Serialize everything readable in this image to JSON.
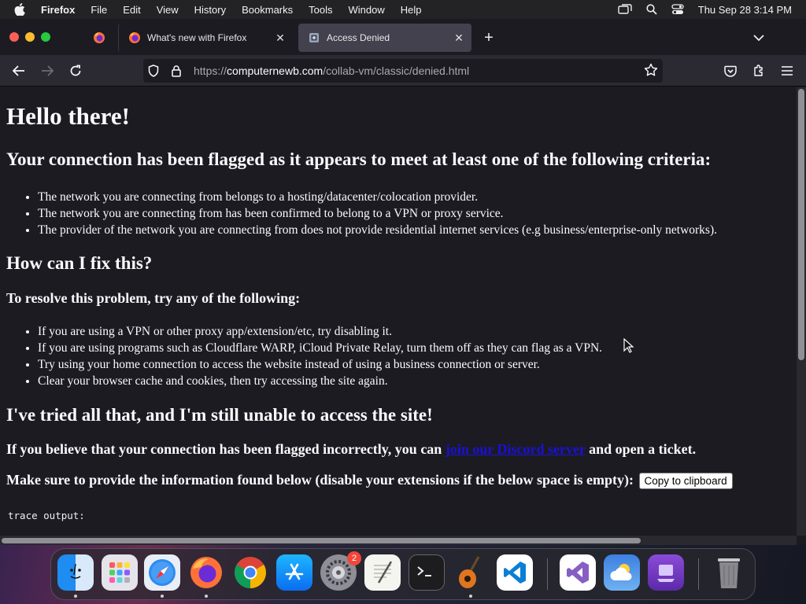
{
  "menubar": {
    "app_name": "Firefox",
    "items": [
      "File",
      "Edit",
      "View",
      "History",
      "Bookmarks",
      "Tools",
      "Window",
      "Help"
    ],
    "clock": "Thu Sep 28  3:14 PM"
  },
  "tabs": [
    {
      "title": "What's new with Firefox",
      "active": false
    },
    {
      "title": "Access Denied",
      "active": true
    }
  ],
  "urlbar": {
    "scheme": "https://",
    "host": "computernewb.com",
    "path": "/collab-vm/classic/denied.html"
  },
  "page": {
    "h1": "Hello there!",
    "h2_flagged": "Your connection has been flagged as it appears to meet at least one of the following criteria:",
    "criteria": [
      "The network you are connecting from belongs to a hosting/datacenter/colocation provider.",
      "The network you are connecting from has been confirmed to belong to a VPN or proxy service.",
      "The provider of the network you are connecting from does not provide residential internet services (e.g business/enterprise-only networks)."
    ],
    "h2_fix": "How can I fix this?",
    "h3_resolve": "To resolve this problem, try any of the following:",
    "fixes": [
      "If you are using a VPN or other proxy app/extension/etc, try disabling it.",
      "If you are using programs such as Cloudflare WARP, iCloud Private Relay, turn them off as they can flag as a VPN.",
      "Try using your home connection to access the website instead of using a business connection or server.",
      "Clear your browser cache and cookies, then try accessing the site again."
    ],
    "h2_tried": "I've tried all that, and I'm still unable to access the site!",
    "incorrect_prefix": "If you believe that your connection has been flagged incorrectly, you can ",
    "discord_link": "join our Discord server",
    "incorrect_suffix": " and open a ticket.",
    "info_text": "Make sure to provide the information found below (disable your extensions if the below space is empty): ",
    "copy_button": "Copy to clipboard",
    "trace_label": "trace output:"
  },
  "dock": {
    "settings_badge": "2",
    "apps": [
      "Finder",
      "Launchpad",
      "Safari",
      "Firefox",
      "Chrome",
      "App Store",
      "System Settings",
      "TextEdit",
      "Terminal",
      "GarageBand",
      "Visual Studio Code",
      "Visual Studio",
      "Weather",
      "Simulator",
      "Trash"
    ]
  },
  "colors": {
    "link": "#1a10d8",
    "page_bg": "#1c1b22",
    "toolbar_bg": "#2b2a33"
  }
}
